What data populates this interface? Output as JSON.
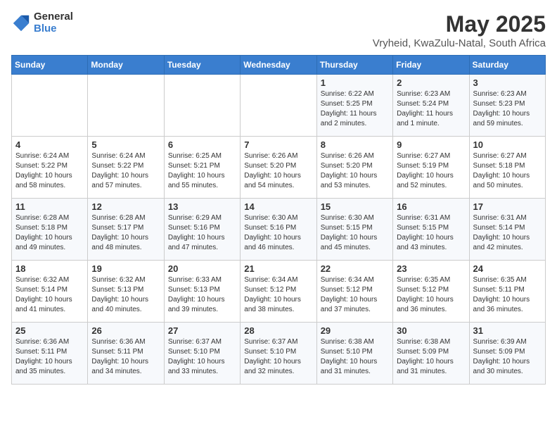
{
  "logo": {
    "general": "General",
    "blue": "Blue"
  },
  "title": {
    "month_year": "May 2025",
    "location": "Vryheid, KwaZulu-Natal, South Africa"
  },
  "headers": [
    "Sunday",
    "Monday",
    "Tuesday",
    "Wednesday",
    "Thursday",
    "Friday",
    "Saturday"
  ],
  "weeks": [
    [
      {
        "day": "",
        "info": ""
      },
      {
        "day": "",
        "info": ""
      },
      {
        "day": "",
        "info": ""
      },
      {
        "day": "",
        "info": ""
      },
      {
        "day": "1",
        "info": "Sunrise: 6:22 AM\nSunset: 5:25 PM\nDaylight: 11 hours\nand 2 minutes."
      },
      {
        "day": "2",
        "info": "Sunrise: 6:23 AM\nSunset: 5:24 PM\nDaylight: 11 hours\nand 1 minute."
      },
      {
        "day": "3",
        "info": "Sunrise: 6:23 AM\nSunset: 5:23 PM\nDaylight: 10 hours\nand 59 minutes."
      }
    ],
    [
      {
        "day": "4",
        "info": "Sunrise: 6:24 AM\nSunset: 5:22 PM\nDaylight: 10 hours\nand 58 minutes."
      },
      {
        "day": "5",
        "info": "Sunrise: 6:24 AM\nSunset: 5:22 PM\nDaylight: 10 hours\nand 57 minutes."
      },
      {
        "day": "6",
        "info": "Sunrise: 6:25 AM\nSunset: 5:21 PM\nDaylight: 10 hours\nand 55 minutes."
      },
      {
        "day": "7",
        "info": "Sunrise: 6:26 AM\nSunset: 5:20 PM\nDaylight: 10 hours\nand 54 minutes."
      },
      {
        "day": "8",
        "info": "Sunrise: 6:26 AM\nSunset: 5:20 PM\nDaylight: 10 hours\nand 53 minutes."
      },
      {
        "day": "9",
        "info": "Sunrise: 6:27 AM\nSunset: 5:19 PM\nDaylight: 10 hours\nand 52 minutes."
      },
      {
        "day": "10",
        "info": "Sunrise: 6:27 AM\nSunset: 5:18 PM\nDaylight: 10 hours\nand 50 minutes."
      }
    ],
    [
      {
        "day": "11",
        "info": "Sunrise: 6:28 AM\nSunset: 5:18 PM\nDaylight: 10 hours\nand 49 minutes."
      },
      {
        "day": "12",
        "info": "Sunrise: 6:28 AM\nSunset: 5:17 PM\nDaylight: 10 hours\nand 48 minutes."
      },
      {
        "day": "13",
        "info": "Sunrise: 6:29 AM\nSunset: 5:16 PM\nDaylight: 10 hours\nand 47 minutes."
      },
      {
        "day": "14",
        "info": "Sunrise: 6:30 AM\nSunset: 5:16 PM\nDaylight: 10 hours\nand 46 minutes."
      },
      {
        "day": "15",
        "info": "Sunrise: 6:30 AM\nSunset: 5:15 PM\nDaylight: 10 hours\nand 45 minutes."
      },
      {
        "day": "16",
        "info": "Sunrise: 6:31 AM\nSunset: 5:15 PM\nDaylight: 10 hours\nand 43 minutes."
      },
      {
        "day": "17",
        "info": "Sunrise: 6:31 AM\nSunset: 5:14 PM\nDaylight: 10 hours\nand 42 minutes."
      }
    ],
    [
      {
        "day": "18",
        "info": "Sunrise: 6:32 AM\nSunset: 5:14 PM\nDaylight: 10 hours\nand 41 minutes."
      },
      {
        "day": "19",
        "info": "Sunrise: 6:32 AM\nSunset: 5:13 PM\nDaylight: 10 hours\nand 40 minutes."
      },
      {
        "day": "20",
        "info": "Sunrise: 6:33 AM\nSunset: 5:13 PM\nDaylight: 10 hours\nand 39 minutes."
      },
      {
        "day": "21",
        "info": "Sunrise: 6:34 AM\nSunset: 5:12 PM\nDaylight: 10 hours\nand 38 minutes."
      },
      {
        "day": "22",
        "info": "Sunrise: 6:34 AM\nSunset: 5:12 PM\nDaylight: 10 hours\nand 37 minutes."
      },
      {
        "day": "23",
        "info": "Sunrise: 6:35 AM\nSunset: 5:12 PM\nDaylight: 10 hours\nand 36 minutes."
      },
      {
        "day": "24",
        "info": "Sunrise: 6:35 AM\nSunset: 5:11 PM\nDaylight: 10 hours\nand 36 minutes."
      }
    ],
    [
      {
        "day": "25",
        "info": "Sunrise: 6:36 AM\nSunset: 5:11 PM\nDaylight: 10 hours\nand 35 minutes."
      },
      {
        "day": "26",
        "info": "Sunrise: 6:36 AM\nSunset: 5:11 PM\nDaylight: 10 hours\nand 34 minutes."
      },
      {
        "day": "27",
        "info": "Sunrise: 6:37 AM\nSunset: 5:10 PM\nDaylight: 10 hours\nand 33 minutes."
      },
      {
        "day": "28",
        "info": "Sunrise: 6:37 AM\nSunset: 5:10 PM\nDaylight: 10 hours\nand 32 minutes."
      },
      {
        "day": "29",
        "info": "Sunrise: 6:38 AM\nSunset: 5:10 PM\nDaylight: 10 hours\nand 31 minutes."
      },
      {
        "day": "30",
        "info": "Sunrise: 6:38 AM\nSunset: 5:09 PM\nDaylight: 10 hours\nand 31 minutes."
      },
      {
        "day": "31",
        "info": "Sunrise: 6:39 AM\nSunset: 5:09 PM\nDaylight: 10 hours\nand 30 minutes."
      }
    ]
  ]
}
